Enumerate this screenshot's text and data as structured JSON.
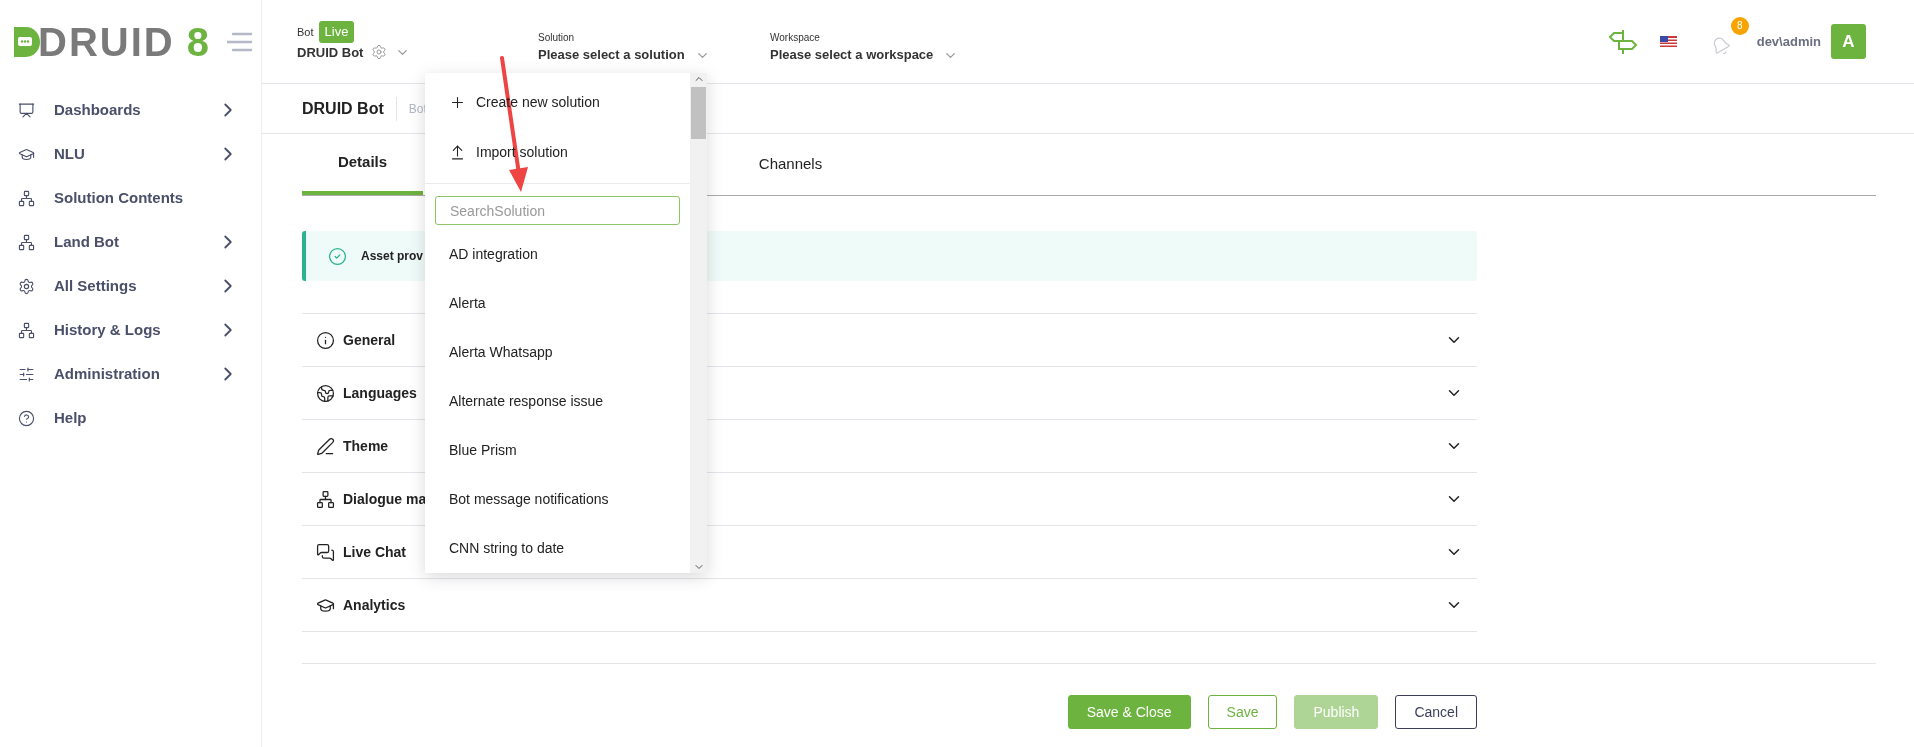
{
  "logo": {
    "text": "DRUID",
    "version": "8"
  },
  "sidebar": {
    "items": [
      {
        "label": "Dashboards",
        "expandable": true
      },
      {
        "label": "NLU",
        "expandable": true
      },
      {
        "label": "Solution Contents",
        "expandable": false
      },
      {
        "label": "Land Bot",
        "expandable": true
      },
      {
        "label": "All Settings",
        "expandable": true
      },
      {
        "label": "History & Logs",
        "expandable": true
      },
      {
        "label": "Administration",
        "expandable": true
      },
      {
        "label": "Help",
        "expandable": false
      }
    ]
  },
  "header": {
    "bot": {
      "label": "Bot",
      "badge": "Live",
      "value": "DRUID Bot"
    },
    "solution": {
      "label": "Solution",
      "value": "Please select a solution"
    },
    "workspace": {
      "label": "Workspace",
      "value": "Please select a workspace"
    },
    "notifications": {
      "count": "8"
    },
    "user": {
      "name": "dev\\admin",
      "avatar": "A"
    }
  },
  "page": {
    "title": "DRUID Bot",
    "subtitle": "Bot",
    "tabs": [
      {
        "label": "Details",
        "selected": true
      },
      {
        "label": "Channels",
        "selected": false
      }
    ],
    "alert": {
      "text": "Asset prov"
    },
    "sections": [
      {
        "label": "General",
        "expanded": false
      },
      {
        "label": "Languages",
        "expanded": false
      },
      {
        "label": "Theme",
        "expanded": false
      },
      {
        "label": "Dialogue ma",
        "expanded": false
      },
      {
        "label": "Live Chat",
        "expanded": false
      },
      {
        "label": "Analytics",
        "expanded": false
      }
    ],
    "buttons": [
      {
        "label": "Save & Close",
        "kind": "primary",
        "disabled": false
      },
      {
        "label": "Save",
        "kind": "outline",
        "disabled": false
      },
      {
        "label": "Publish",
        "kind": "primary",
        "disabled": true
      },
      {
        "label": "Cancel",
        "kind": "secondary",
        "disabled": false
      }
    ]
  },
  "solution_dropdown": {
    "actions": [
      {
        "label": "Create new solution",
        "kind": "create"
      },
      {
        "label": "Import solution",
        "kind": "import"
      }
    ],
    "search": {
      "placeholder": "SearchSolution"
    },
    "options": [
      "AD integration",
      "Alerta",
      "Alerta Whatsapp",
      "Alternate response issue",
      "Blue Prism",
      "Bot message notifications",
      "CNN string to date"
    ]
  }
}
